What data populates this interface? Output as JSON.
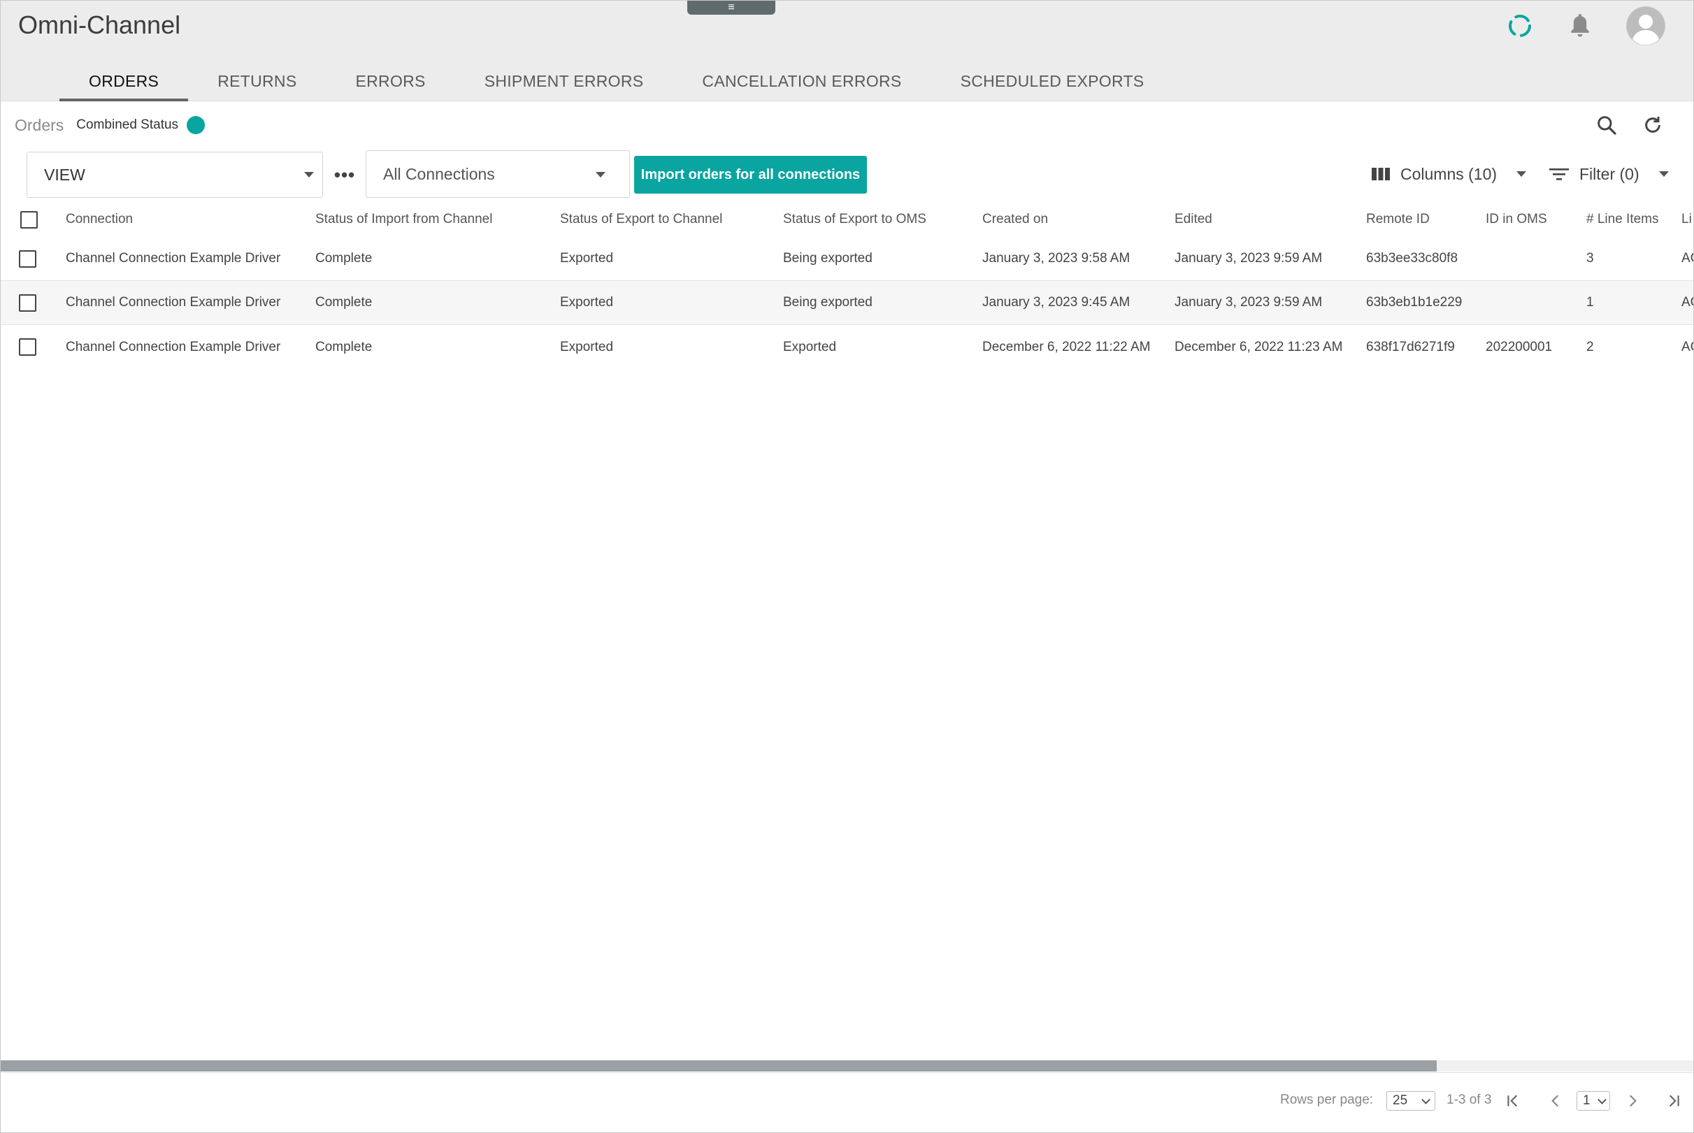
{
  "app": {
    "title": "Omni-Channel",
    "menu_glyph": "≡"
  },
  "tabs": [
    {
      "label": "ORDERS",
      "active": true
    },
    {
      "label": "RETURNS",
      "active": false
    },
    {
      "label": "ERRORS",
      "active": false
    },
    {
      "label": "SHIPMENT ERRORS",
      "active": false
    },
    {
      "label": "CANCELLATION ERRORS",
      "active": false
    },
    {
      "label": "SCHEDULED EXPORTS",
      "active": false
    }
  ],
  "breadcrumb": {
    "section": "Orders",
    "status_label": "Combined Status",
    "status_color": "#0aa5a0"
  },
  "toolbar": {
    "view_label": "VIEW",
    "more_label": "•••",
    "connection_value": "All Connections",
    "import_label": "Import orders for all connections",
    "columns_label": "Columns (10)",
    "filter_label": "Filter (0)"
  },
  "table": {
    "columns": [
      "Connection",
      "Status of Import from Channel",
      "Status of Export to Channel",
      "Status of Export to OMS",
      "Created on",
      "Edited",
      "Remote ID",
      "ID in OMS",
      "# Line Items",
      "Li"
    ],
    "rows": [
      [
        "Channel Connection Example Driver",
        "Complete",
        "Exported",
        "Being exported",
        "January 3, 2023 9:58 AM",
        "January 3, 2023 9:59 AM",
        "63b3ee33c80f8",
        "",
        "3",
        "AC"
      ],
      [
        "Channel Connection Example Driver",
        "Complete",
        "Exported",
        "Being exported",
        "January 3, 2023 9:45 AM",
        "January 3, 2023 9:59 AM",
        "63b3eb1b1e229",
        "",
        "1",
        "AC"
      ],
      [
        "Channel Connection Example Driver",
        "Complete",
        "Exported",
        "Exported",
        "December 6, 2022 11:22 AM",
        "December 6, 2022 11:23 AM",
        "638f17d6271f9",
        "202200001",
        "2",
        "AC"
      ]
    ]
  },
  "pagination": {
    "rows_per_page_label": "Rows per page:",
    "rows_per_page_value": "25",
    "range_text": "1-3 of 3",
    "page_value": "1"
  },
  "colors": {
    "accent": "#0aa5a0",
    "header_bg": "#ececec",
    "scrollbar": "#9aa0a3"
  }
}
